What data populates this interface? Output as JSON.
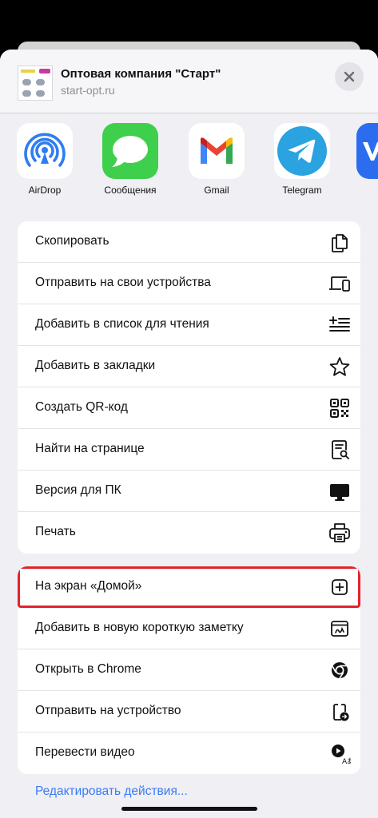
{
  "header": {
    "title": "Оптовая компания \"Старт\"",
    "url": "start-opt.ru"
  },
  "apps": [
    {
      "label": "AirDrop",
      "icon": "airdrop-icon"
    },
    {
      "label": "Сообщения",
      "icon": "messages-icon"
    },
    {
      "label": "Gmail",
      "icon": "gmail-icon"
    },
    {
      "label": "Telegram",
      "icon": "telegram-icon"
    }
  ],
  "group1": [
    {
      "label": "Скопировать",
      "icon": "copy-icon"
    },
    {
      "label": "Отправить на свои устройства",
      "icon": "devices-icon"
    },
    {
      "label": "Добавить в список для чтения",
      "icon": "reading-list-icon"
    },
    {
      "label": "Добавить в закладки",
      "icon": "star-icon"
    },
    {
      "label": "Создать QR-код",
      "icon": "qr-code-icon"
    },
    {
      "label": "Найти на странице",
      "icon": "find-in-page-icon"
    },
    {
      "label": "Версия для ПК",
      "icon": "desktop-icon"
    },
    {
      "label": "Печать",
      "icon": "printer-icon"
    }
  ],
  "group2": [
    {
      "label": "На экран «Домой»",
      "icon": "add-square-icon",
      "highlighted": true
    },
    {
      "label": "Добавить в новую короткую заметку",
      "icon": "quick-note-icon"
    },
    {
      "label": "Открыть в Chrome",
      "icon": "chrome-icon"
    },
    {
      "label": "Отправить на устройство",
      "icon": "send-to-device-icon"
    },
    {
      "label": "Перевести видео",
      "icon": "translate-video-icon"
    }
  ],
  "edit_actions": "Редактировать действия...",
  "colors": {
    "highlight": "#e0242a",
    "link": "#3a7bf5",
    "telegram": "#2aa3e0",
    "messages": "#3ecf4c",
    "airdrop": "#2f7df0"
  }
}
